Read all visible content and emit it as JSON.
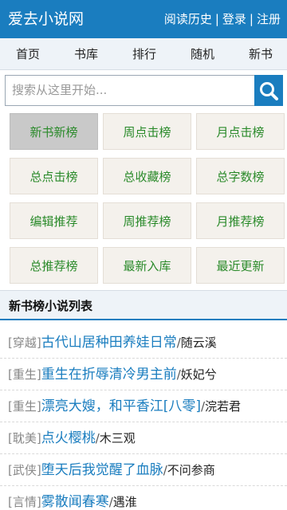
{
  "header": {
    "logo": "爱去小说网",
    "links": [
      "阅读历史",
      "登录",
      "注册"
    ],
    "separator": "|"
  },
  "nav": [
    "首页",
    "书库",
    "排行",
    "随机",
    "新书"
  ],
  "search": {
    "placeholder": "搜索从这里开始..."
  },
  "grid": [
    {
      "label": "新书新榜",
      "active": true
    },
    {
      "label": "周点击榜"
    },
    {
      "label": "月点击榜"
    },
    {
      "label": "总点击榜"
    },
    {
      "label": "总收藏榜"
    },
    {
      "label": "总字数榜"
    },
    {
      "label": "编辑推荐"
    },
    {
      "label": "周推荐榜"
    },
    {
      "label": "月推荐榜"
    },
    {
      "label": "总推荐榜"
    },
    {
      "label": "最新入库"
    },
    {
      "label": "最近更新"
    }
  ],
  "section": {
    "title": "新书榜小说列表"
  },
  "list": [
    {
      "tag": "[穿越]",
      "title": "古代山居种田养娃日常",
      "author": "随云溪"
    },
    {
      "tag": "[重生]",
      "title": "重生在折辱清冷男主前",
      "author": "妖妃兮"
    },
    {
      "tag": "[重生]",
      "title": "漂亮大嫂，和平香江[八零]",
      "author": "浣若君"
    },
    {
      "tag": "[耽美]",
      "title": "点火樱桃",
      "author": "木三观"
    },
    {
      "tag": "[武侠]",
      "title": "堕天后我觉醒了血脉",
      "author": "不问参商"
    },
    {
      "tag": "[言情]",
      "title": "雾散闻春寒",
      "author": "遇淮"
    }
  ],
  "colors": {
    "brand": "#1a7dbf",
    "green": "#2a8a2a"
  },
  "icons": {
    "search": "search-icon"
  }
}
